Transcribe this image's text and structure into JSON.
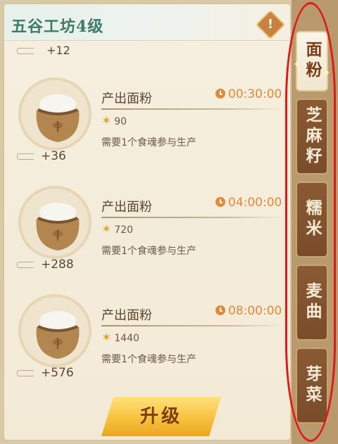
{
  "header": {
    "title": "五谷工坊4级",
    "alert_icon_text": "!"
  },
  "top_count": "+12",
  "recipes": [
    {
      "title": "产出面粉",
      "timer": "00:30:00",
      "cost": "90",
      "requirement": "需要1个食魂参与生产",
      "bonus": "+36"
    },
    {
      "title": "产出面粉",
      "timer": "04:00:00",
      "cost": "720",
      "requirement": "需要1个食魂参与生产",
      "bonus": "+288"
    },
    {
      "title": "产出面粉",
      "timer": "08:00:00",
      "cost": "1440",
      "requirement": "需要1个食魂参与生产",
      "bonus": "+576"
    }
  ],
  "upgrade_label": "升级",
  "tabs": [
    {
      "label": "面粉",
      "active": true
    },
    {
      "label": "芝麻籽",
      "active": false
    },
    {
      "label": "糯米",
      "active": false
    },
    {
      "label": "麦曲",
      "active": false
    },
    {
      "label": "芽菜",
      "active": false
    }
  ],
  "icons": {
    "clock": "clock-icon",
    "wheat": "wheat-icon",
    "sack": "flour-sack-icon",
    "alert": "alert-icon"
  },
  "colors": {
    "title": "#3d7a6a",
    "timer": "#e3893b",
    "highlight": "#e01818",
    "button": "#f7c23e"
  }
}
